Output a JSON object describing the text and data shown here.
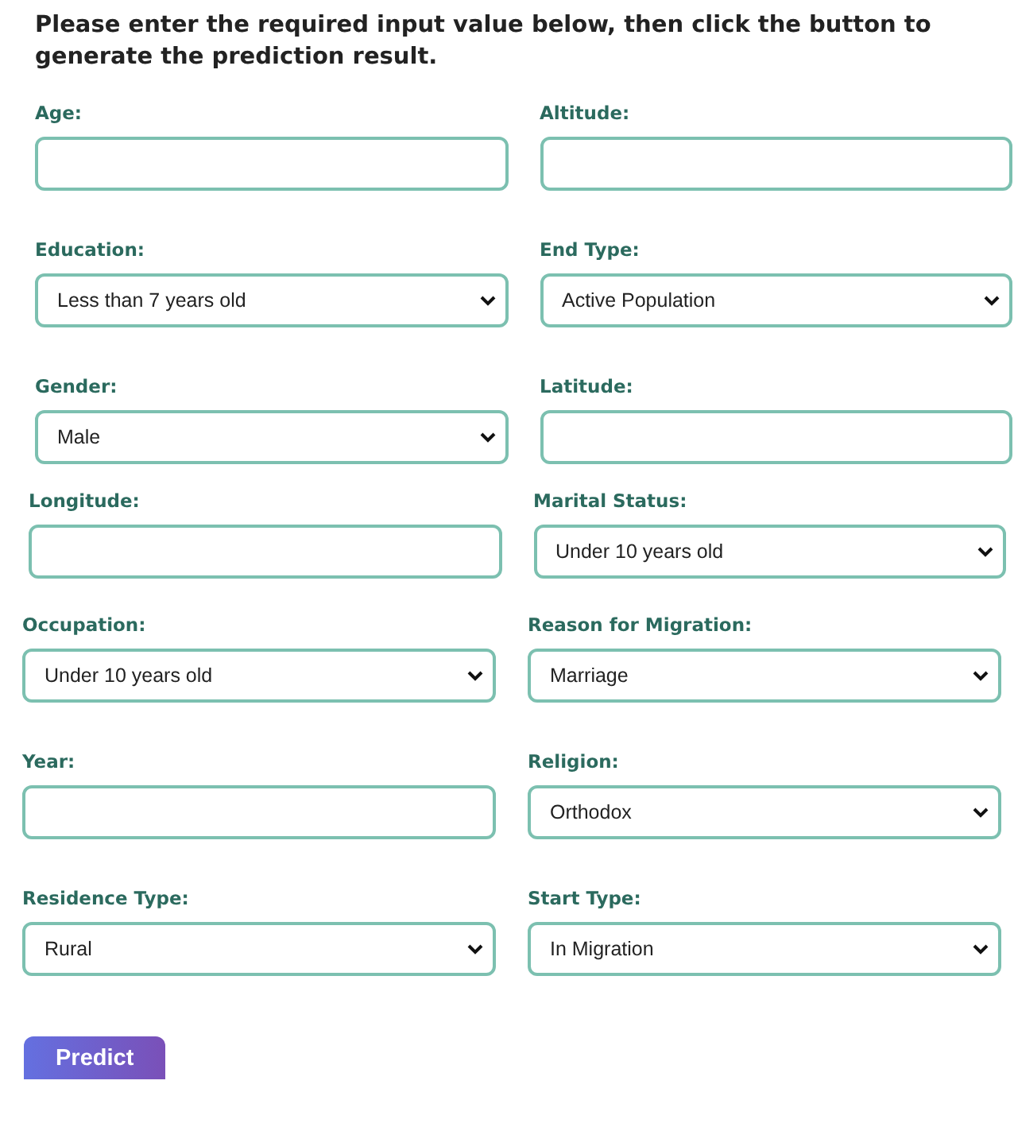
{
  "instructions": "Please enter the required input value below, then click the button to generate the prediction result.",
  "rows": [
    {
      "fields": [
        {
          "label": "Age:",
          "kind": "text"
        },
        {
          "label": "Altitude:",
          "kind": "text"
        }
      ]
    },
    {
      "fields": [
        {
          "label": "Education:",
          "kind": "select",
          "value": "Less than 7 years old"
        },
        {
          "label": "End Type:",
          "kind": "select",
          "value": "Active Population"
        }
      ]
    },
    {
      "fields": [
        {
          "label": "Gender:",
          "kind": "select",
          "value": "Male"
        },
        {
          "label": "Latitude:",
          "kind": "text"
        }
      ]
    },
    {
      "fields": [
        {
          "label": "Longitude:",
          "kind": "text"
        },
        {
          "label": "Marital Status:",
          "kind": "select",
          "value": "Under 10 years old"
        }
      ]
    },
    {
      "fields": [
        {
          "label": "Occupation:",
          "kind": "select",
          "value": "Under 10 years old"
        },
        {
          "label": "Reason for Migration:",
          "kind": "select",
          "value": "Marriage"
        }
      ]
    },
    {
      "fields": [
        {
          "label": "Year:",
          "kind": "text"
        },
        {
          "label": "Religion:",
          "kind": "select",
          "value": "Orthodox"
        }
      ]
    },
    {
      "fields": [
        {
          "label": "Residence Type:",
          "kind": "select",
          "value": "Rural"
        },
        {
          "label": "Start Type:",
          "kind": "select",
          "value": "In Migration"
        }
      ]
    }
  ],
  "button": "Predict"
}
